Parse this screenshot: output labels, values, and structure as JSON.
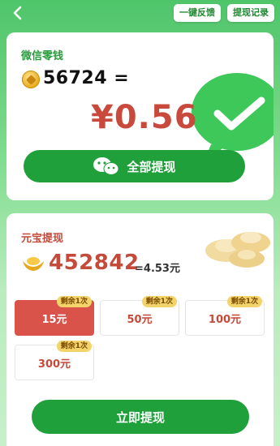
{
  "header": {
    "feedback_label": "一键反馈",
    "records_label": "提现记录"
  },
  "wechat_change": {
    "title": "微信零钱",
    "coins": "56724",
    "equals": "=",
    "amount": "¥0.56",
    "withdraw_all_label": "全部提现"
  },
  "yuanbao": {
    "title": "元宝提现",
    "amount": "452842",
    "equivalent": "=4.53元",
    "options": [
      {
        "label": "15元",
        "tag": "剩余1次",
        "selected": true
      },
      {
        "label": "50元",
        "tag": "剩余1次",
        "selected": false
      },
      {
        "label": "100元",
        "tag": "剩余1次",
        "selected": false
      },
      {
        "label": "300元",
        "tag": "剩余1次",
        "selected": false
      }
    ],
    "withdraw_now_label": "立即提现"
  },
  "colors": {
    "brand_green": "#1fa03a",
    "accent_red": "#c94a3c",
    "selected_red": "#d9534b",
    "tag_yellow": "#f2d46b"
  }
}
